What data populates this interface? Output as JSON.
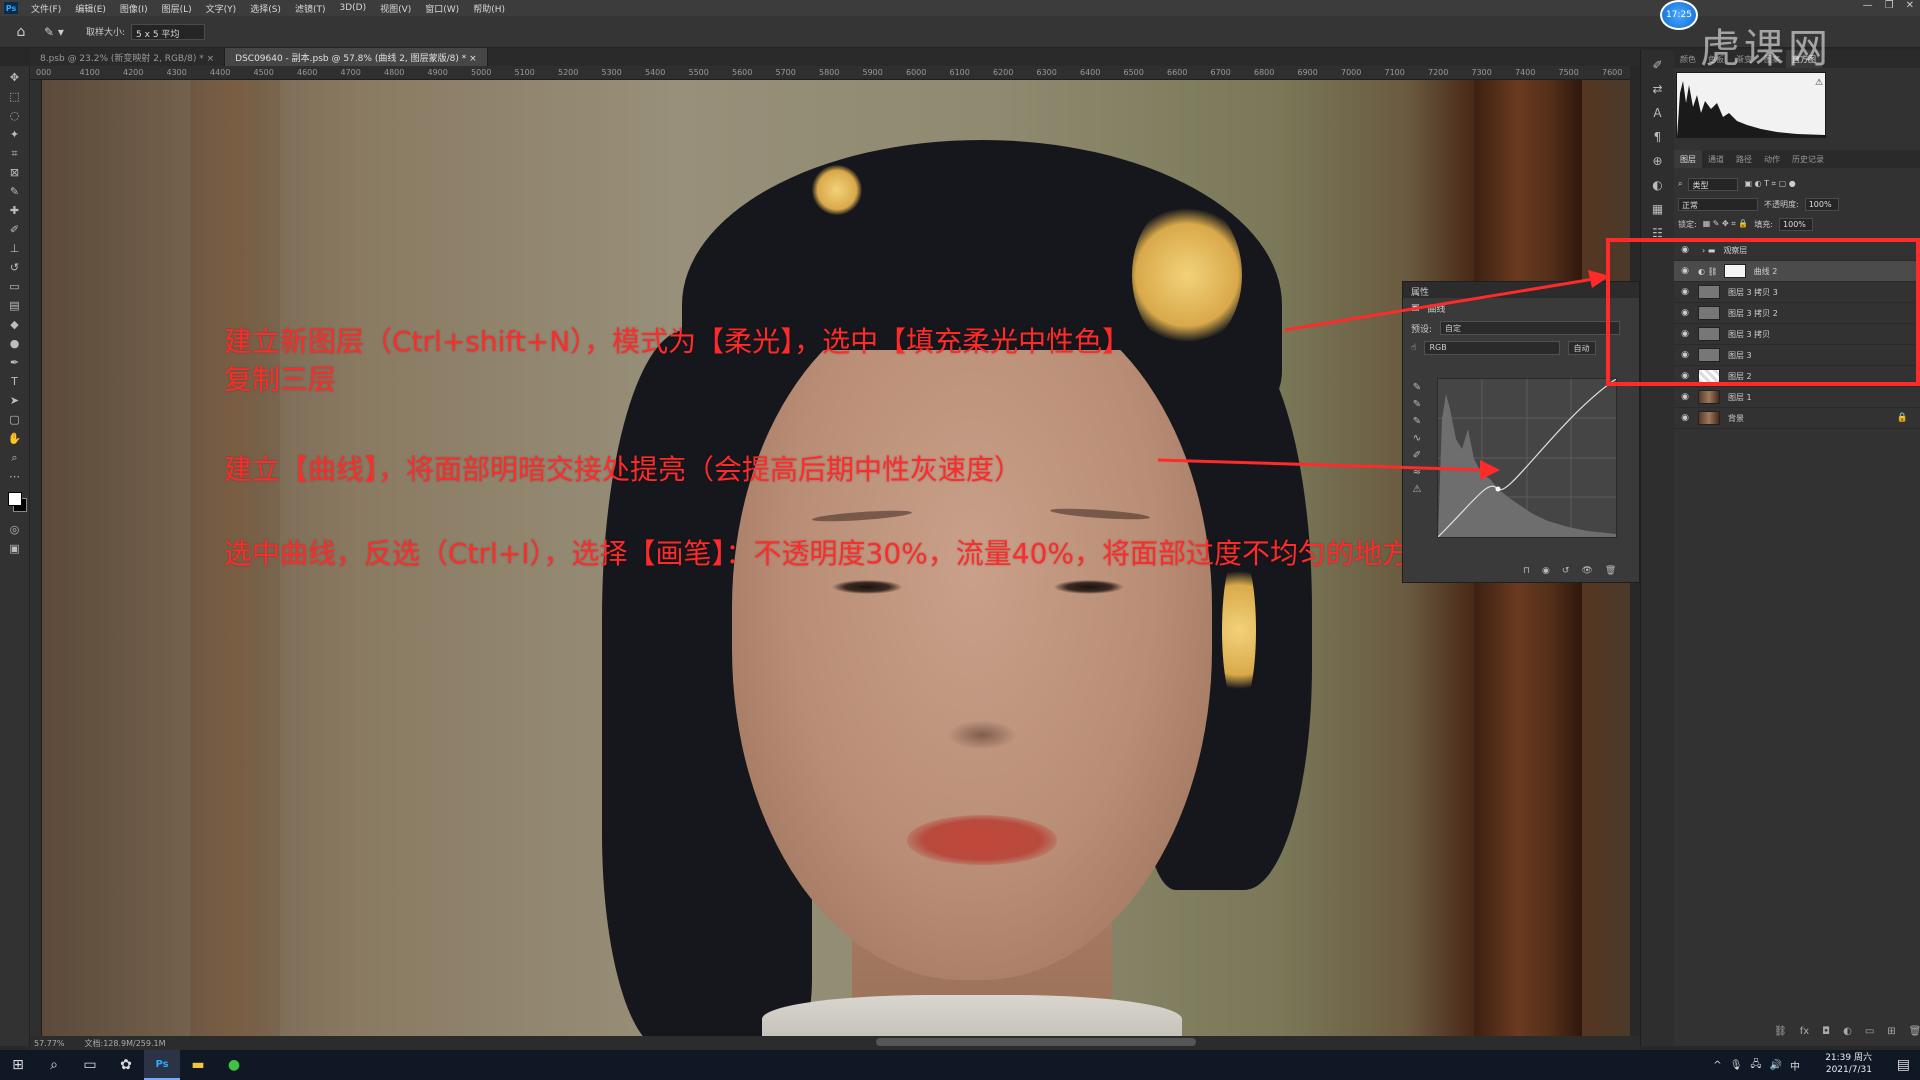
{
  "menu": [
    "文件(F)",
    "编辑(E)",
    "图像(I)",
    "图层(L)",
    "文字(Y)",
    "选择(S)",
    "滤镜(T)",
    "3D(D)",
    "视图(V)",
    "窗口(W)",
    "帮助(H)"
  ],
  "options": {
    "sample_size_label": "取样大小:",
    "sample_size_value": "5 x 5 平均"
  },
  "tabs": [
    "8.psb @ 23.2% (新变映射 2, RGB/8) *",
    "DSC09640 - 副本.psb @ 57.8% (曲线 2, 图层蒙版/8) *"
  ],
  "ruler_ticks": [
    "000",
    "4100",
    "4200",
    "4300",
    "4400",
    "4500",
    "4600",
    "4700",
    "4800",
    "4900",
    "5000",
    "5100",
    "5200",
    "5300",
    "5400",
    "5500",
    "5600",
    "5700",
    "5800",
    "5900",
    "6000",
    "6100",
    "6200",
    "6300",
    "6400",
    "6500",
    "6600",
    "6700",
    "6800",
    "6900",
    "7000",
    "7100",
    "7200",
    "7300",
    "7400",
    "7500",
    "7600"
  ],
  "annotations": {
    "line1": "建立新图层（Ctrl+shift+N），模式为【柔光】，选中【填充柔光中性色】",
    "line2": "复制三层",
    "line3": "建立【曲线】，将面部明暗交接处提亮（会提高后期中性灰速度）",
    "line4": "选中曲线，反选（Ctrl+I），选择【画笔】：不透明度30%，流量40%，将面部过度不均匀的地方擦一下"
  },
  "annotation_color": "#ff2a2a",
  "properties": {
    "title": "属性",
    "type": "曲线",
    "preset_label": "预设:",
    "preset_value": "自定",
    "channel": "RGB",
    "auto": "自动"
  },
  "timer": "17:25",
  "watermark": "虎课网",
  "right_panel": {
    "top_tabs": [
      "颜色",
      "色板",
      "渐变",
      "图案",
      "直方图"
    ],
    "layer_tabs": [
      "图层",
      "通道",
      "路径",
      "动作",
      "历史记录"
    ],
    "filter_label": "类型",
    "blend_mode": "正常",
    "opacity_label": "不透明度:",
    "opacity_value": "100%",
    "lock_label": "锁定:",
    "fill_label": "填充:",
    "fill_value": "100%"
  },
  "layers": [
    {
      "name": "观察层",
      "kind": "group",
      "selected": false
    },
    {
      "name": "曲线 2",
      "kind": "curves",
      "selected": true
    },
    {
      "name": "图层 3 拷贝 3",
      "kind": "gray",
      "selected": false
    },
    {
      "name": "图层 3 拷贝 2",
      "kind": "gray",
      "selected": false
    },
    {
      "name": "图层 3 拷贝",
      "kind": "gray",
      "selected": false
    },
    {
      "name": "图层 3",
      "kind": "gray",
      "selected": false
    },
    {
      "name": "图层 2",
      "kind": "checker",
      "selected": false
    },
    {
      "name": "图层 1",
      "kind": "photo",
      "selected": false
    },
    {
      "name": "背景",
      "kind": "photo",
      "selected": false,
      "locked": true
    }
  ],
  "status": {
    "zoom": "57.77%",
    "doc": "文档:128.9M/259.1M"
  },
  "clock": {
    "time": "21:39 周六",
    "date": "2021/7/31"
  }
}
